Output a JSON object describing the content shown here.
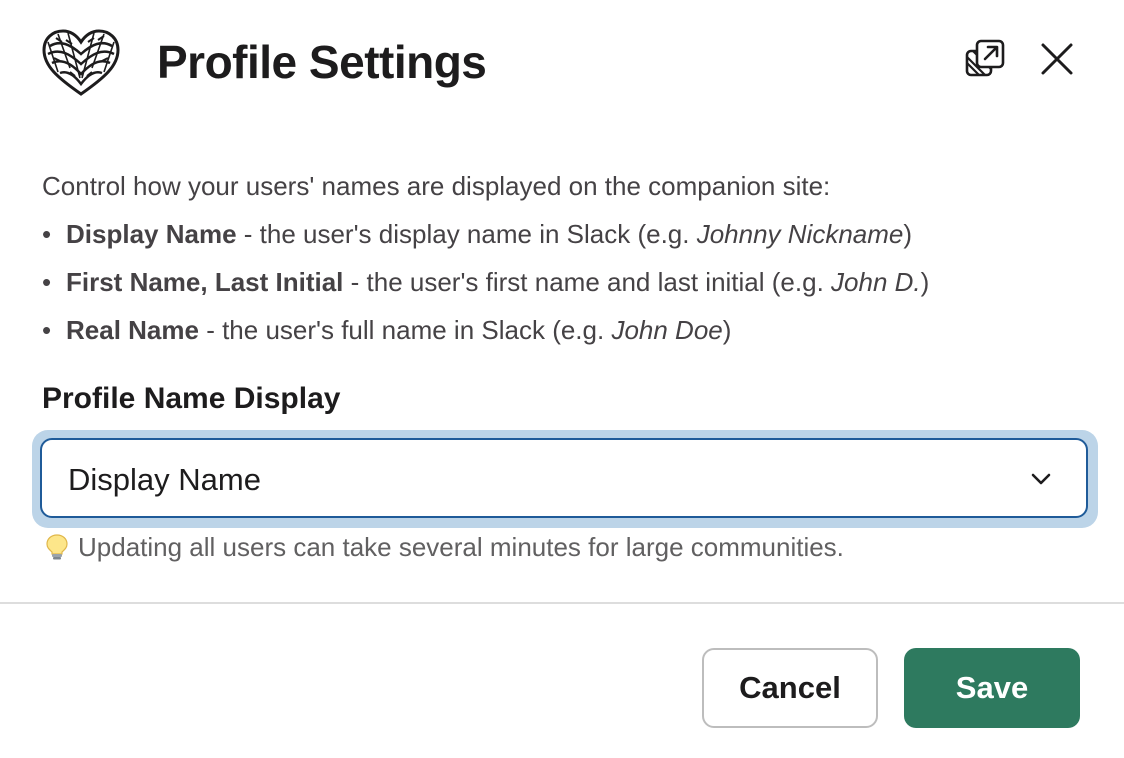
{
  "header": {
    "title": "Profile Settings",
    "logo_icon": "rope-heart-logo",
    "popout_icon": "popout-icon",
    "close_icon": "close-icon"
  },
  "description": {
    "intro": "Control how your users' names are displayed on the companion site:",
    "options": [
      {
        "name": "Display Name",
        "text": " - the user's display name in Slack (e.g. ",
        "example": "Johnny Nickname",
        "suffix": ")"
      },
      {
        "name": "First Name, Last Initial",
        "text": " - the user's first name and last initial (e.g. ",
        "example": "John D.",
        "suffix": ")"
      },
      {
        "name": "Real Name",
        "text": " - the user's full name in Slack (e.g. ",
        "example": "John Doe",
        "suffix": ")"
      }
    ]
  },
  "field": {
    "label": "Profile Name Display",
    "selected_value": "Display Name",
    "hint": "Updating all users can take several minutes for large communities.",
    "hint_icon": "lightbulb-icon"
  },
  "footer": {
    "cancel_label": "Cancel",
    "save_label": "Save"
  },
  "colors": {
    "save_button": "#2e7a5f",
    "focus_ring": "#bcd4e8",
    "select_border": "#1f5b99"
  }
}
